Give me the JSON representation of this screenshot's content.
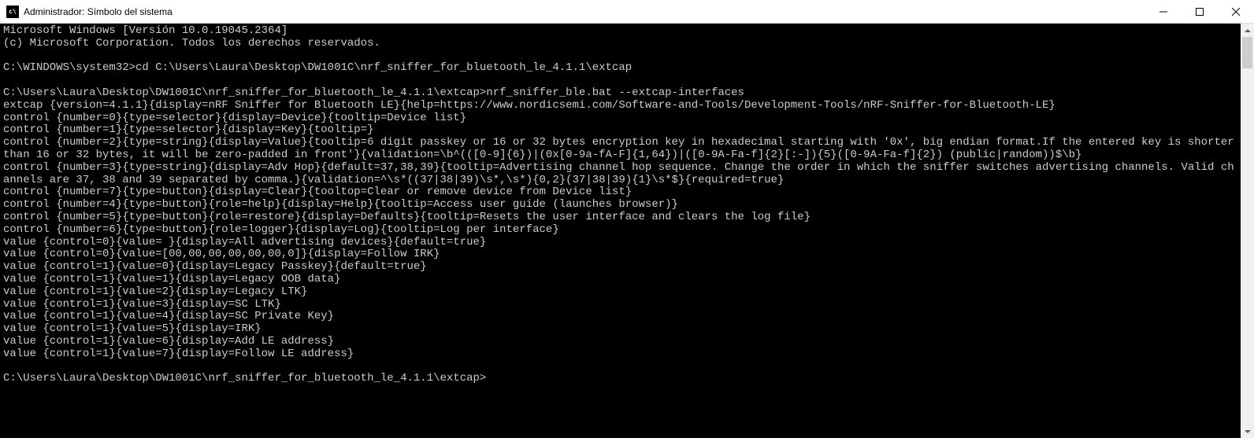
{
  "titlebar": {
    "icon_text": "C:\\",
    "title": "Administrador: Símbolo del sistema"
  },
  "terminal": {
    "lines": [
      "Microsoft Windows [Versión 10.0.19045.2364]",
      "(c) Microsoft Corporation. Todos los derechos reservados.",
      "",
      "C:\\WINDOWS\\system32>cd C:\\Users\\Laura\\Desktop\\DW1001C\\nrf_sniffer_for_bluetooth_le_4.1.1\\extcap",
      "",
      "C:\\Users\\Laura\\Desktop\\DW1001C\\nrf_sniffer_for_bluetooth_le_4.1.1\\extcap>nrf_sniffer_ble.bat --extcap-interfaces",
      "extcap {version=4.1.1}{display=nRF Sniffer for Bluetooth LE}{help=https://www.nordicsemi.com/Software-and-Tools/Development-Tools/nRF-Sniffer-for-Bluetooth-LE}",
      "control {number=0}{type=selector}{display=Device}{tooltip=Device list}",
      "control {number=1}{type=selector}{display=Key}{tooltip=}",
      "control {number=2}{type=string}{display=Value}{tooltip=6 digit passkey or 16 or 32 bytes encryption key in hexadecimal starting with '0x', big endian format.If the entered key is shorter than 16 or 32 bytes, it will be zero-padded in front'}{validation=\\b^(([0-9]{6})|(0x[0-9a-fA-F]{1,64})|([0-9A-Fa-f]{2}[:-]){5}([0-9A-Fa-f]{2}) (public|random))$\\b}",
      "control {number=3}{type=string}{display=Adv Hop}{default=37,38,39}{tooltip=Advertising channel hop sequence. Change the order in which the sniffer switches advertising channels. Valid channels are 37, 38 and 39 separated by comma.}{validation=^\\s*((37|38|39)\\s*,\\s*){0,2}(37|38|39){1}\\s*$}{required=true}",
      "control {number=7}{type=button}{display=Clear}{tooltop=Clear or remove device from Device list}",
      "control {number=4}{type=button}{role=help}{display=Help}{tooltip=Access user guide (launches browser)}",
      "control {number=5}{type=button}{role=restore}{display=Defaults}{tooltip=Resets the user interface and clears the log file}",
      "control {number=6}{type=button}{role=logger}{display=Log}{tooltip=Log per interface}",
      "value {control=0}{value= }{display=All advertising devices}{default=true}",
      "value {control=0}{value=[00,00,00,00,00,00,0]}{display=Follow IRK}",
      "value {control=1}{value=0}{display=Legacy Passkey}{default=true}",
      "value {control=1}{value=1}{display=Legacy OOB data}",
      "value {control=1}{value=2}{display=Legacy LTK}",
      "value {control=1}{value=3}{display=SC LTK}",
      "value {control=1}{value=4}{display=SC Private Key}",
      "value {control=1}{value=5}{display=IRK}",
      "value {control=1}{value=6}{display=Add LE address}",
      "value {control=1}{value=7}{display=Follow LE address}",
      "",
      "C:\\Users\\Laura\\Desktop\\DW1001C\\nrf_sniffer_for_bluetooth_le_4.1.1\\extcap>"
    ]
  }
}
